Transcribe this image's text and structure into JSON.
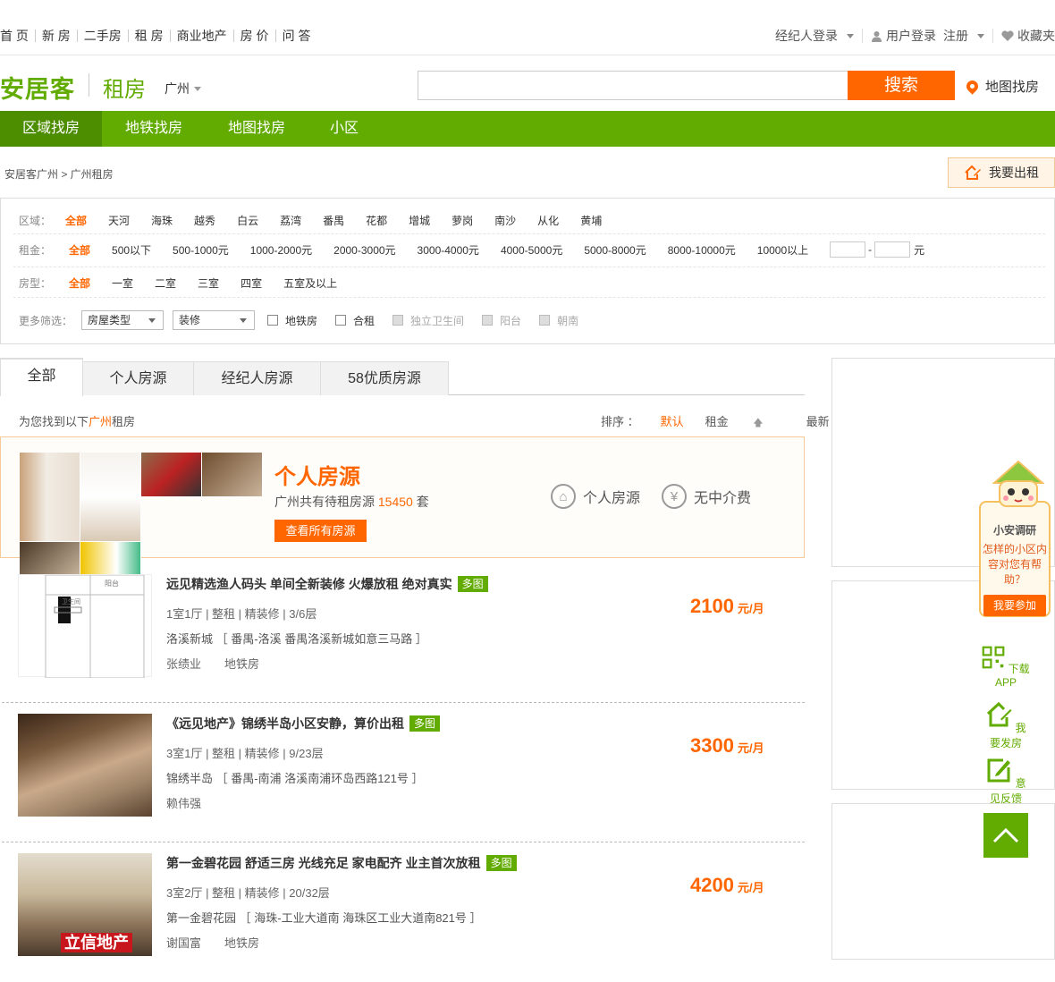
{
  "topnav": [
    "首 页",
    "新 房",
    "二手房",
    "租 房",
    "商业地产",
    "房 价",
    "问 答"
  ],
  "topright": {
    "agent_login": "经纪人登录",
    "user_login": "用户登录",
    "register": "注册",
    "favorites": "收藏夹"
  },
  "header": {
    "logo": "安居客",
    "channel": "租房",
    "city": "广州",
    "search_placeholder": "",
    "search_button": "搜索",
    "map_link": "地图找房"
  },
  "greennav": [
    "区域找房",
    "地铁找房",
    "地图找房",
    "小区"
  ],
  "breadcrumb": "安居客广州 > 广州租房",
  "rent_button": "我要出租",
  "filters": {
    "region": {
      "label": "区域：",
      "options": [
        "全部",
        "天河",
        "海珠",
        "越秀",
        "白云",
        "荔湾",
        "番禺",
        "花都",
        "增城",
        "萝岗",
        "南沙",
        "从化",
        "黄埔"
      ]
    },
    "rent": {
      "label": "租金：",
      "options": [
        "全部",
        "500以下",
        "500-1000元",
        "1000-2000元",
        "2000-3000元",
        "3000-4000元",
        "4000-5000元",
        "5000-8000元",
        "8000-10000元",
        "10000以上"
      ],
      "dash": "-",
      "unit": "元"
    },
    "rooms": {
      "label": "房型：",
      "options": [
        "全部",
        "一室",
        "二室",
        "三室",
        "四室",
        "五室及以上"
      ]
    },
    "more": {
      "label": "更多筛选：",
      "select1": "房屋类型",
      "select2": "装修",
      "checks": [
        "地铁房",
        "合租"
      ],
      "disabled_checks": [
        "独立卫生间",
        "阳台",
        "朝南"
      ]
    }
  },
  "tabs": [
    "全部",
    "个人房源",
    "经纪人房源",
    "58优质房源"
  ],
  "result": {
    "prefix": "为您找到以下",
    "city": "广州",
    "suffix": "租房"
  },
  "sort": {
    "label": "排序 ：",
    "default": "默认",
    "rent": "租金",
    "newest": "最新"
  },
  "promo": {
    "title": "个人房源",
    "count_prefix": "广州共有待租房源",
    "count": "15450",
    "count_suffix": "套",
    "button": "查看所有房源",
    "feature1": "个人房源",
    "feature2": "无中介费"
  },
  "listings": [
    {
      "title": "远见精选渔人码头 单间全新装修 火爆放租 绝对真实",
      "tag": "多图",
      "spec": "1室1厅 | 整租 | 精装修 | 3/6层",
      "community": "洛溪新城",
      "address": "［ 番禺-洛溪 番禺洛溪新城如意三马路 ］",
      "agent": "张绩业",
      "subway": "地铁房",
      "price": "2100",
      "unit": "元/月"
    },
    {
      "title": "《远见地产》锦绣半岛小区安静，算价出租",
      "tag": "多图",
      "spec": "3室1厅 | 整租 | 精装修 | 9/23层",
      "community": "锦绣半岛",
      "address": "［ 番禺-南浦 洛溪南浦环岛西路121号 ］",
      "agent": "赖伟强",
      "subway": "",
      "price": "3300",
      "unit": "元/月"
    },
    {
      "title": "第一金碧花园 舒适三房 光线充足 家电配齐 业主首次放租",
      "tag": "多图",
      "spec": "3室2厅 | 整租 | 精装修 | 20/32层",
      "community": "第一金碧花园",
      "address": "［ 海珠-工业大道南 海珠区工业大道南821号 ］",
      "agent": "谢国富",
      "subway": "地铁房",
      "price": "4200",
      "unit": "元/月"
    }
  ],
  "thumb_texts": {
    "floorplan_label1": "阳台",
    "floorplan_label2": "卫生间",
    "watermark": "立信地产"
  },
  "survey": {
    "title": "小安调研",
    "question": "怎样的小区内容对您有帮助？",
    "button": "我要参加"
  },
  "side": {
    "app": "下载APP",
    "post": "我要发房",
    "feedback": "意见反馈"
  },
  "colors": {
    "green": "#62ab00",
    "orange": "#ff6600"
  }
}
